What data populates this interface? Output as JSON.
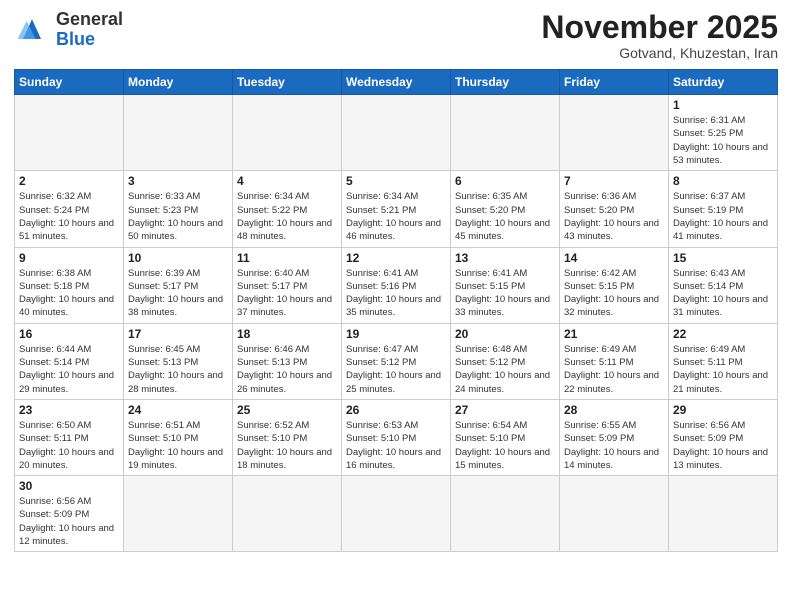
{
  "logo": {
    "general": "General",
    "blue": "Blue"
  },
  "calendar": {
    "title": "November 2025",
    "subtitle": "Gotvand, Khuzestan, Iran",
    "days_of_week": [
      "Sunday",
      "Monday",
      "Tuesday",
      "Wednesday",
      "Thursday",
      "Friday",
      "Saturday"
    ],
    "weeks": [
      [
        {
          "day": "",
          "info": ""
        },
        {
          "day": "",
          "info": ""
        },
        {
          "day": "",
          "info": ""
        },
        {
          "day": "",
          "info": ""
        },
        {
          "day": "",
          "info": ""
        },
        {
          "day": "",
          "info": ""
        },
        {
          "day": "1",
          "info": "Sunrise: 6:31 AM\nSunset: 5:25 PM\nDaylight: 10 hours and 53 minutes."
        }
      ],
      [
        {
          "day": "2",
          "info": "Sunrise: 6:32 AM\nSunset: 5:24 PM\nDaylight: 10 hours and 51 minutes."
        },
        {
          "day": "3",
          "info": "Sunrise: 6:33 AM\nSunset: 5:23 PM\nDaylight: 10 hours and 50 minutes."
        },
        {
          "day": "4",
          "info": "Sunrise: 6:34 AM\nSunset: 5:22 PM\nDaylight: 10 hours and 48 minutes."
        },
        {
          "day": "5",
          "info": "Sunrise: 6:34 AM\nSunset: 5:21 PM\nDaylight: 10 hours and 46 minutes."
        },
        {
          "day": "6",
          "info": "Sunrise: 6:35 AM\nSunset: 5:20 PM\nDaylight: 10 hours and 45 minutes."
        },
        {
          "day": "7",
          "info": "Sunrise: 6:36 AM\nSunset: 5:20 PM\nDaylight: 10 hours and 43 minutes."
        },
        {
          "day": "8",
          "info": "Sunrise: 6:37 AM\nSunset: 5:19 PM\nDaylight: 10 hours and 41 minutes."
        }
      ],
      [
        {
          "day": "9",
          "info": "Sunrise: 6:38 AM\nSunset: 5:18 PM\nDaylight: 10 hours and 40 minutes."
        },
        {
          "day": "10",
          "info": "Sunrise: 6:39 AM\nSunset: 5:17 PM\nDaylight: 10 hours and 38 minutes."
        },
        {
          "day": "11",
          "info": "Sunrise: 6:40 AM\nSunset: 5:17 PM\nDaylight: 10 hours and 37 minutes."
        },
        {
          "day": "12",
          "info": "Sunrise: 6:41 AM\nSunset: 5:16 PM\nDaylight: 10 hours and 35 minutes."
        },
        {
          "day": "13",
          "info": "Sunrise: 6:41 AM\nSunset: 5:15 PM\nDaylight: 10 hours and 33 minutes."
        },
        {
          "day": "14",
          "info": "Sunrise: 6:42 AM\nSunset: 5:15 PM\nDaylight: 10 hours and 32 minutes."
        },
        {
          "day": "15",
          "info": "Sunrise: 6:43 AM\nSunset: 5:14 PM\nDaylight: 10 hours and 31 minutes."
        }
      ],
      [
        {
          "day": "16",
          "info": "Sunrise: 6:44 AM\nSunset: 5:14 PM\nDaylight: 10 hours and 29 minutes."
        },
        {
          "day": "17",
          "info": "Sunrise: 6:45 AM\nSunset: 5:13 PM\nDaylight: 10 hours and 28 minutes."
        },
        {
          "day": "18",
          "info": "Sunrise: 6:46 AM\nSunset: 5:13 PM\nDaylight: 10 hours and 26 minutes."
        },
        {
          "day": "19",
          "info": "Sunrise: 6:47 AM\nSunset: 5:12 PM\nDaylight: 10 hours and 25 minutes."
        },
        {
          "day": "20",
          "info": "Sunrise: 6:48 AM\nSunset: 5:12 PM\nDaylight: 10 hours and 24 minutes."
        },
        {
          "day": "21",
          "info": "Sunrise: 6:49 AM\nSunset: 5:11 PM\nDaylight: 10 hours and 22 minutes."
        },
        {
          "day": "22",
          "info": "Sunrise: 6:49 AM\nSunset: 5:11 PM\nDaylight: 10 hours and 21 minutes."
        }
      ],
      [
        {
          "day": "23",
          "info": "Sunrise: 6:50 AM\nSunset: 5:11 PM\nDaylight: 10 hours and 20 minutes."
        },
        {
          "day": "24",
          "info": "Sunrise: 6:51 AM\nSunset: 5:10 PM\nDaylight: 10 hours and 19 minutes."
        },
        {
          "day": "25",
          "info": "Sunrise: 6:52 AM\nSunset: 5:10 PM\nDaylight: 10 hours and 18 minutes."
        },
        {
          "day": "26",
          "info": "Sunrise: 6:53 AM\nSunset: 5:10 PM\nDaylight: 10 hours and 16 minutes."
        },
        {
          "day": "27",
          "info": "Sunrise: 6:54 AM\nSunset: 5:10 PM\nDaylight: 10 hours and 15 minutes."
        },
        {
          "day": "28",
          "info": "Sunrise: 6:55 AM\nSunset: 5:09 PM\nDaylight: 10 hours and 14 minutes."
        },
        {
          "day": "29",
          "info": "Sunrise: 6:56 AM\nSunset: 5:09 PM\nDaylight: 10 hours and 13 minutes."
        }
      ],
      [
        {
          "day": "30",
          "info": "Sunrise: 6:56 AM\nSunset: 5:09 PM\nDaylight: 10 hours and 12 minutes."
        },
        {
          "day": "",
          "info": ""
        },
        {
          "day": "",
          "info": ""
        },
        {
          "day": "",
          "info": ""
        },
        {
          "day": "",
          "info": ""
        },
        {
          "day": "",
          "info": ""
        },
        {
          "day": "",
          "info": ""
        }
      ]
    ]
  }
}
